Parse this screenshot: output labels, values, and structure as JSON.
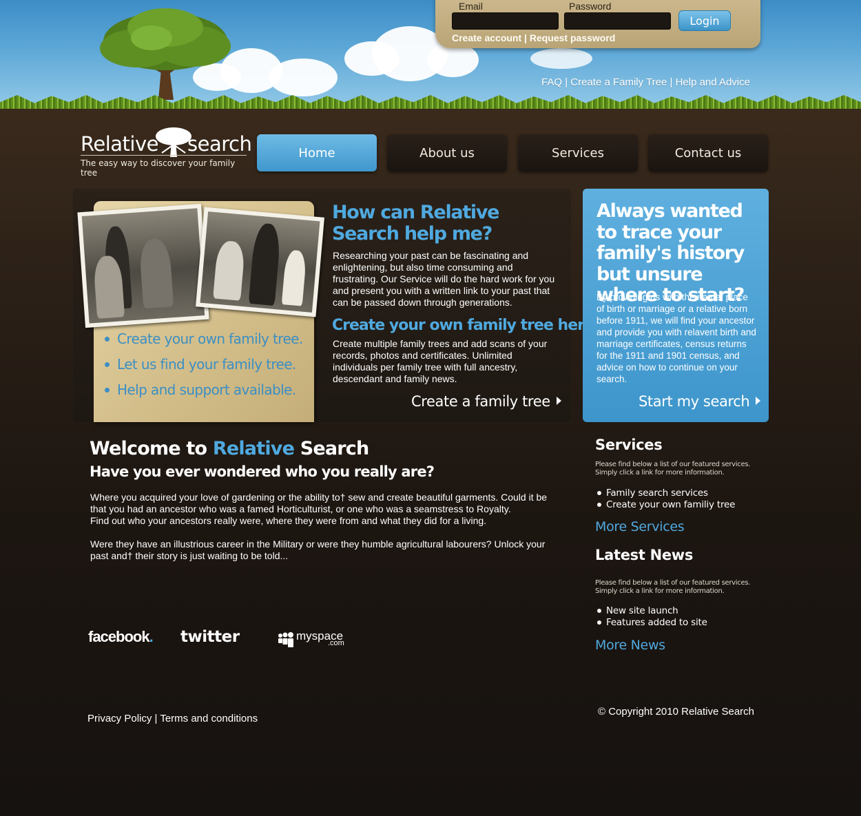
{
  "login": {
    "email_label": "Email",
    "password_label": "Password",
    "email_value": "",
    "password_value": "",
    "login_button": "Login",
    "create_account": "Create account",
    "separator": "|",
    "request_password": "Request password"
  },
  "top_links": [
    "FAQ",
    "Create a Family Tree",
    "Help and Advice"
  ],
  "top_links_separator": "|",
  "logo": {
    "part1": "Relative",
    "part2": "search",
    "tagline": "The easy way to discover your family tree"
  },
  "nav": [
    {
      "label": "Home",
      "active": true
    },
    {
      "label": "About us",
      "active": false
    },
    {
      "label": "Services",
      "active": false
    },
    {
      "label": "Contact us",
      "active": false
    }
  ],
  "feature": {
    "bullets": [
      "Create your own family tree.",
      "Let us find your family tree.",
      "Help and support available."
    ],
    "heading": "How can Relative Search help me?",
    "intro": "Researching your past can be fascinating and enlightening, but also time consuming and frustrating. Our Service will do the hard work for you and present you with a written link to your past that can be passed down through generations.",
    "subheading": "Create your own family tree here.",
    "body": "Create multiple family trees and add scans of your records, photos and certificates. Unlimited individuals per family tree with full ancestry, descendant and family news.",
    "cta": "Create a family tree"
  },
  "bluebox": {
    "heading": "Always wanted to trace your family's history but unsure where to start?",
    "body": "By providing us with the name, place of birth or marriage or a relative born before 1911, we will find your ancestor and provide you with relavent birth and marriage certificates, census returns for the 1911 and 1901 census, and advice on how to continue on your search.",
    "cta": "Start my search"
  },
  "welcome": {
    "title_prefix": "Welcome to ",
    "title_accent": "Relative",
    "title_suffix": " Search",
    "subtitle": "Have you ever wondered who you really are?",
    "para1": "Where you acquired your love of gardening or the ability to† sew and create beautiful garments. Could it be that you had an ancestor who was a famed Horticulturist, or one who was a seamstress to Royalty.",
    "para2": "Find out who your ancestors really were, where they were from and what they did for a living.",
    "para3": "Were they have an illustrious career in the Military or were they humble agricultural labourers? Unlock your past and† their story is just waiting to be told..."
  },
  "social": {
    "facebook": "facebook",
    "facebook_dot": ".",
    "twitter": "twitter",
    "myspace": "myspace",
    "myspace_com": ".com"
  },
  "sidebar": {
    "services": {
      "heading": "Services",
      "note_line1": "Please find below a list of our featured services.",
      "note_line2": "Simply click a link for more information.",
      "items": [
        "Family search services",
        "Create your own familiy tree"
      ],
      "more": "More Services"
    },
    "news": {
      "heading": "Latest News",
      "note_line1": "Please find below a list of our featured services.",
      "note_line2": "Simply click a link for more information.",
      "items": [
        "New site launch",
        "Features added to site"
      ],
      "more": "More News"
    }
  },
  "footer": {
    "privacy": "Privacy Policy",
    "separator": "|",
    "terms": "Terms and conditions",
    "copyright": "© Copyright 2010 Relative Search"
  },
  "colors": {
    "accent_blue": "#4fa9df",
    "soil_dark": "#19130f",
    "parchment": "#d9c596"
  }
}
